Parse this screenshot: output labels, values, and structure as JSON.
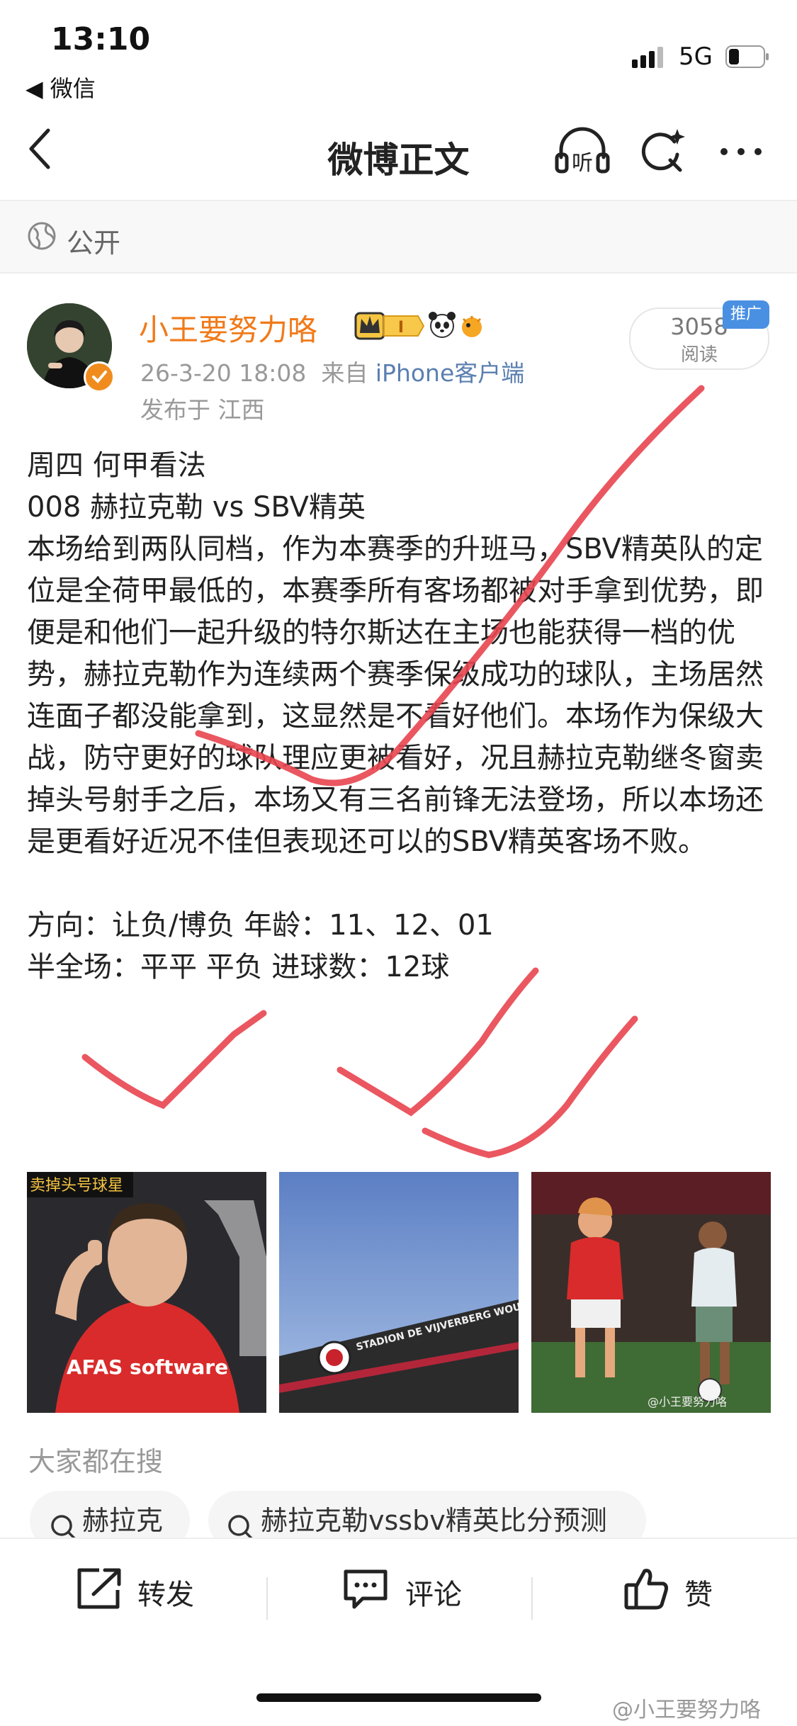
{
  "status_bar": {
    "time": "13:10",
    "back_app": "◀ 微信",
    "network": "5G"
  },
  "nav": {
    "title": "微博正文",
    "listen_label": "听"
  },
  "visibility": {
    "label": "公开"
  },
  "post": {
    "username": "小王要努力咯",
    "badge_level": "I",
    "timestamp": "26-3-20 18:08",
    "source_prefix": "来自",
    "source": "iPhone客户端",
    "location": "发布于 江西",
    "read_count": "3058",
    "read_label": "阅读",
    "promo_tag": "推广",
    "body": [
      "周四 何甲看法",
      "008  赫拉克勒 vs SBV精英",
      "本场给到两队同档，作为本赛季的升班马，SBV精英队的定位是全荷甲最低的，本赛季所有客场都被对手拿到优势，即便是和他们一起升级的特尔斯达在主场也能获得一档的优势，赫拉克勒作为连续两个赛季保级成功的球队，主场居然连面子都没能拿到，这显然是不看好他们。本场作为保级大战，防守更好的球队理应更被看好，况且赫拉克勒继冬窗卖掉头号射手之后，本场又有三名前锋无法登场，所以本场还是更看好近况不佳但表现还可以的SBV精英客场不败。",
      "",
      "方向：让负/博负    年龄：11、12、01",
      "半全场：平平 平负   进球数：12球"
    ],
    "image1_caption": "卖掉头号球星",
    "image1_jersey": "AFAS software",
    "image2_sign": "STADION DE VIJVERBERG WOUDESTEIN",
    "image3_watermark": "@小王要努力咯"
  },
  "trending": {
    "label": "大家都在搜",
    "chips": [
      "赫拉克",
      "赫拉克勒vssbv精英比分预测"
    ]
  },
  "actions": {
    "repost": "转发",
    "comment": "评论",
    "like": "赞"
  },
  "watermark": "@小王要努力咯",
  "colors": {
    "username": "#f07a1a",
    "source": "#5a7fb0",
    "annotation": "#e8454f",
    "promo": "#4a90e2"
  }
}
